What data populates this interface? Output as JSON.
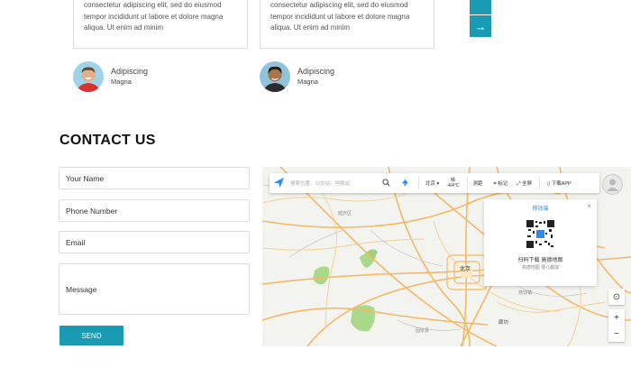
{
  "testimonials": [
    {
      "text": "consectetur adipiscing elit, sed do eiusmod tempor incididunt ut labore et dolore magna aliqua. Ut enim ad minim",
      "name": "Adipiscing",
      "role": "Magna"
    },
    {
      "text": "consectetur adipiscing elit, sed do eiusmod tempor incididunt ut labore et dolore magna aliqua. Ut enim ad minim",
      "name": "Adipiscing",
      "role": "Magna"
    }
  ],
  "nav": {
    "next_glyph": "→"
  },
  "contact": {
    "title": "CONTACT US",
    "name_placeholder": "Your Name",
    "phone_placeholder": "Phone Number",
    "email_placeholder": "Email",
    "message_placeholder": "Message",
    "send_label": "SEND"
  },
  "map": {
    "search_placeholder": "搜索位置、公交站、地铁站",
    "city": "北京",
    "weather_label": "晴",
    "temperature": "-4/4°C",
    "range_label": "测距",
    "mark_label": "标记",
    "fullscreen_label": "全屏",
    "download_app_label": "下载APP",
    "popup_title": "移动端",
    "popup_scan": "扫码下载 高德地图",
    "popup_sub": "高德地图 便儿都能",
    "place_labels": [
      "北京",
      "廊坊",
      "燕郊镇",
      "延庆区",
      "固安县"
    ]
  }
}
